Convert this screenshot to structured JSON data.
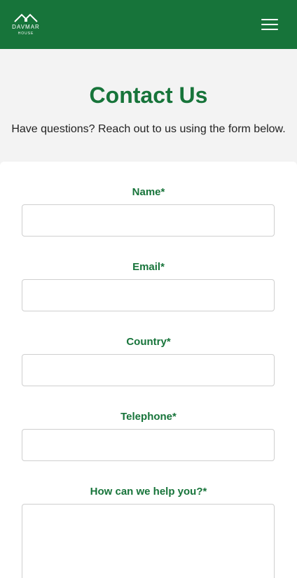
{
  "header": {
    "logo_name": "DAVMAR",
    "logo_sub": "HOUSE",
    "menu_icon": "hamburger-menu-icon",
    "brand_color": "#17743a"
  },
  "hero": {
    "title": "Contact Us",
    "subtitle": "Have questions? Reach out to us using the form below."
  },
  "form": {
    "name_label": "Name*",
    "email_label": "Email*",
    "country_label": "Country*",
    "telephone_label": "Telephone*",
    "message_label": "How can we help you?*",
    "name_value": "",
    "email_value": "",
    "country_value": "",
    "telephone_value": "",
    "message_value": ""
  }
}
